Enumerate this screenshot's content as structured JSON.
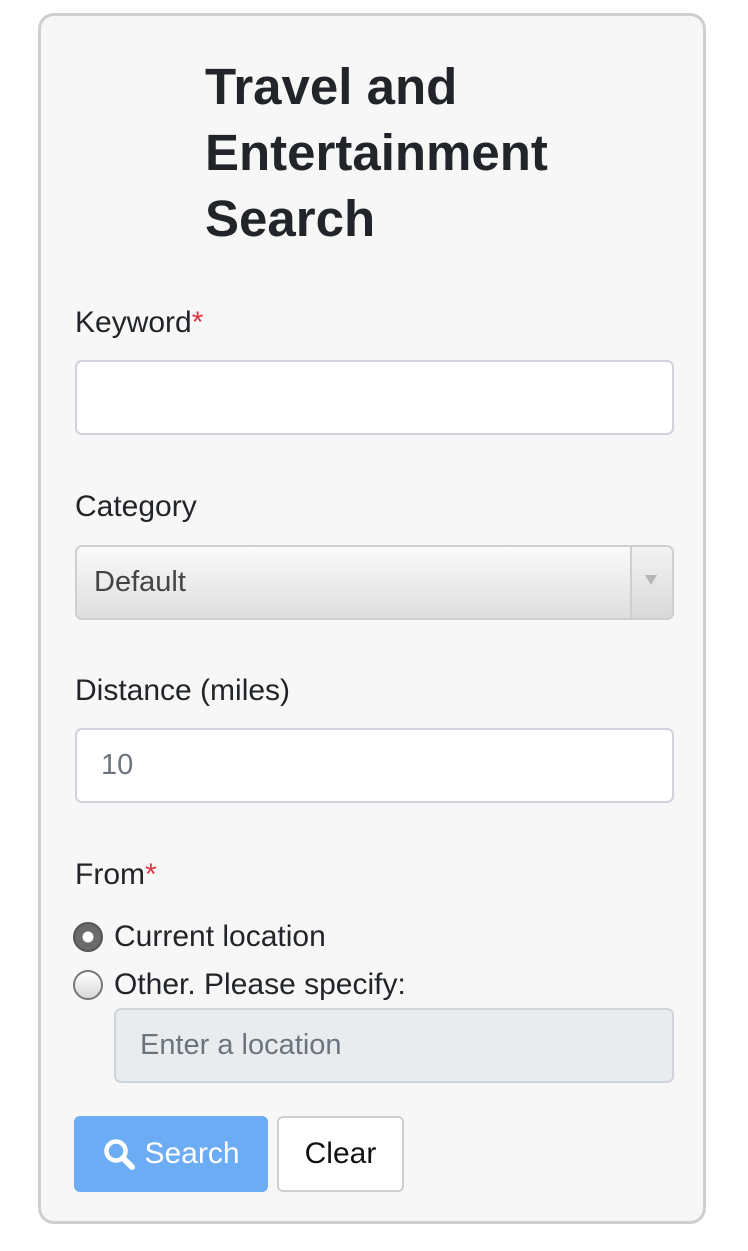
{
  "form": {
    "title": "Travel and Entertainment Search",
    "required_mark": "*",
    "keyword": {
      "label": "Keyword",
      "value": "",
      "placeholder": ""
    },
    "category": {
      "label": "Category",
      "selected": "Default"
    },
    "distance": {
      "label": "Distance (miles)",
      "value": "",
      "placeholder": "10"
    },
    "from": {
      "label": "From",
      "options": [
        {
          "label": "Current location",
          "checked": true
        },
        {
          "label": "Other. Please specify:",
          "checked": false
        }
      ],
      "location_placeholder": "Enter a location"
    },
    "buttons": {
      "search_label": "Search",
      "search_icon": "search-icon",
      "search_color": "#6cacf5",
      "clear_label": "Clear"
    }
  }
}
